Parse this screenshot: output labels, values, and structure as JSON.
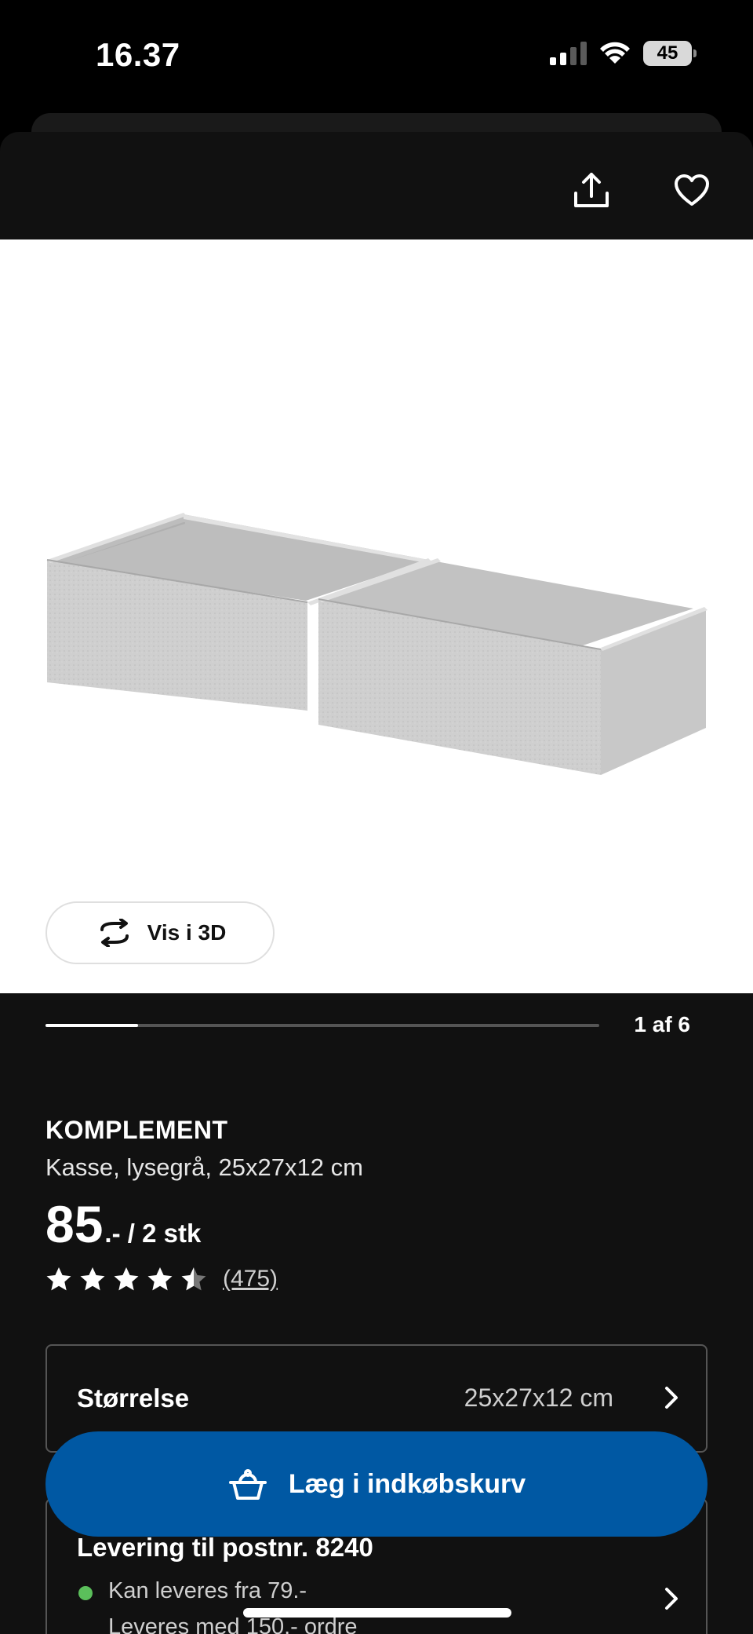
{
  "status_bar": {
    "time": "16.37",
    "battery": "45"
  },
  "header": {
    "share_icon": "share-icon",
    "favorite_icon": "heart-icon"
  },
  "gallery": {
    "view3d_label": "Vis i 3D",
    "counter": "1 af 6",
    "progress_fraction": 0.1667
  },
  "product": {
    "brand": "KOMPLEMENT",
    "description": "Kasse, lysegrå, 25x27x12 cm",
    "price_main": "85",
    "price_suffix": ".- / 2 stk",
    "rating": 4.5,
    "review_count": "(475)"
  },
  "size": {
    "label": "Størrelse",
    "value": "25x27x12 cm"
  },
  "delivery": {
    "title": "Levering til postnr. 8240",
    "line1": "Kan leveres fra 79.-",
    "line2": "Leveres med 150.- ordre"
  },
  "cart_button": {
    "label": "Læg i indkøbskurv"
  },
  "colors": {
    "accent": "#0058a3",
    "available": "#5bbf5b",
    "background": "#111111"
  }
}
